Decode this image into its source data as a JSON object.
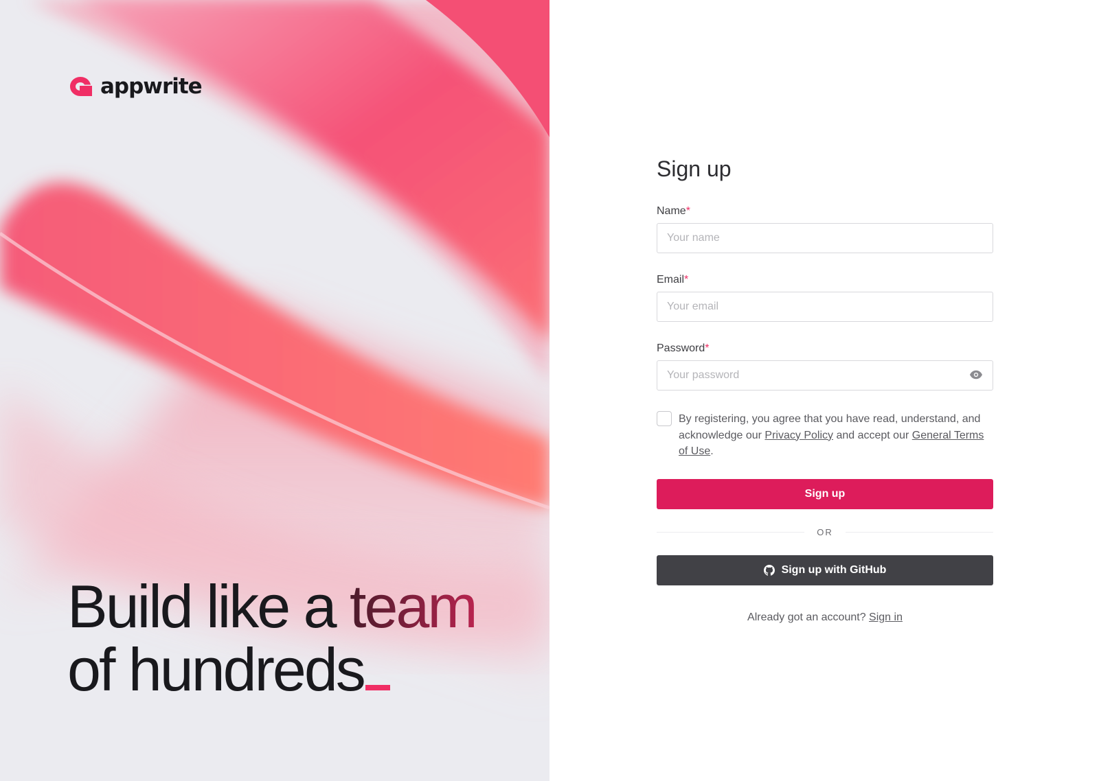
{
  "brand": {
    "name": "appwrite",
    "logo_icon": "appwrite-logo-icon",
    "accent_color": "#f02e65"
  },
  "hero": {
    "line1_prefix": "Build like a ",
    "line1_accent": "team",
    "line2": "of hundreds"
  },
  "form": {
    "title": "Sign up",
    "fields": [
      {
        "label": "Name",
        "required_mark": "*",
        "placeholder": "Your name",
        "value": ""
      },
      {
        "label": "Email",
        "required_mark": "*",
        "placeholder": "Your email",
        "value": ""
      },
      {
        "label": "Password",
        "required_mark": "*",
        "placeholder": "Your password",
        "value": "",
        "toggle_icon": "eye-icon"
      }
    ],
    "terms": {
      "checked": false,
      "text_before": "By registering, you agree that you have read, understand, and acknowledge our ",
      "privacy_link": "Privacy Policy",
      "text_middle": " and accept our ",
      "terms_link": "General Terms of Use",
      "text_after": "."
    },
    "submit_label": "Sign up",
    "divider_label": "OR",
    "github_label": "Sign up with GitHub",
    "github_icon": "github-icon",
    "footer_text": "Already got an account? ",
    "signin_link": "Sign in"
  },
  "colors": {
    "primary_button": "#dd1c5b",
    "github_button": "#414146",
    "left_panel_bg": "#ebebf0"
  }
}
